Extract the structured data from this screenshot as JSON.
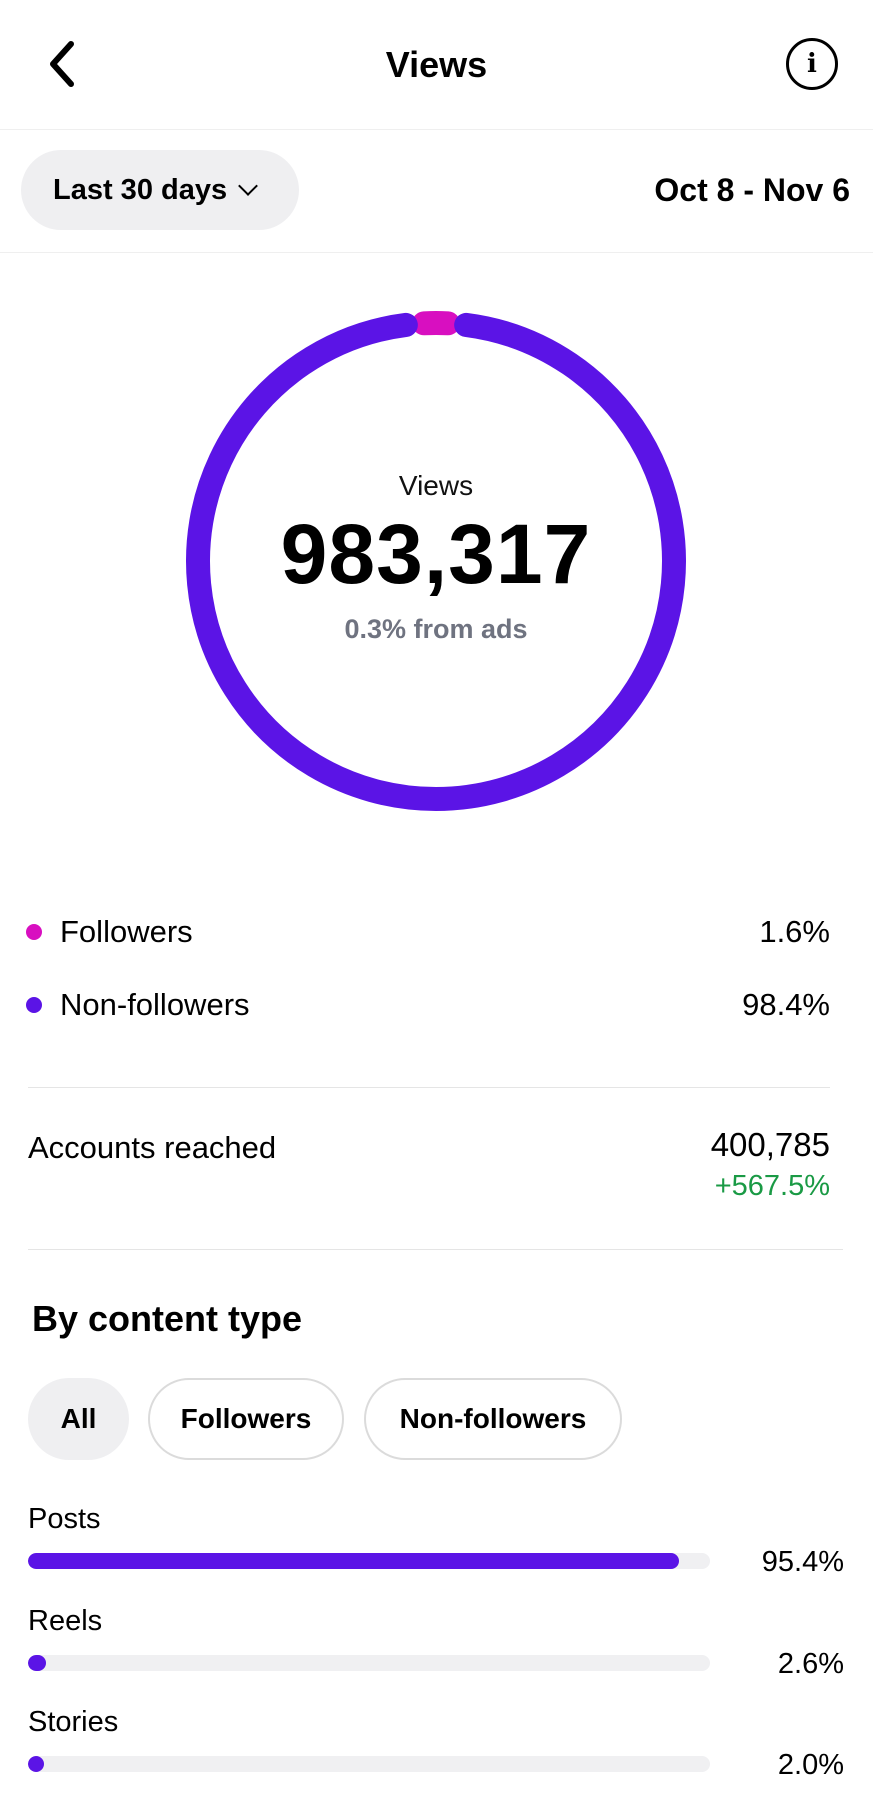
{
  "header": {
    "title": "Views",
    "back_icon": "chevron-left-icon",
    "info_icon": "info-icon"
  },
  "filter": {
    "range_label": "Last 30 days",
    "date_range": "Oct 8 - Nov 6"
  },
  "summary": {
    "label": "Views",
    "total": "983,317",
    "ads_note": "0.3% from ads",
    "followers_fraction": 0.016,
    "nonfollowers_fraction": 0.984
  },
  "colors": {
    "followers": "#d80fc0",
    "non_followers": "#5b14e6",
    "positive": "#1a9a45",
    "muted": "#6f7380"
  },
  "audience": [
    {
      "label": "Followers",
      "value": "1.6%"
    },
    {
      "label": "Non-followers",
      "value": "98.4%"
    }
  ],
  "reach": {
    "label": "Accounts reached",
    "value": "400,785",
    "change": "+567.5%"
  },
  "content_type": {
    "title": "By content type",
    "tabs": [
      "All",
      "Followers",
      "Non-followers"
    ],
    "rows": [
      {
        "label": "Posts",
        "value": "95.4%",
        "fraction": 0.954
      },
      {
        "label": "Reels",
        "value": "2.6%",
        "fraction": 0.026
      },
      {
        "label": "Stories",
        "value": "2.0%",
        "fraction": 0.02
      }
    ]
  }
}
